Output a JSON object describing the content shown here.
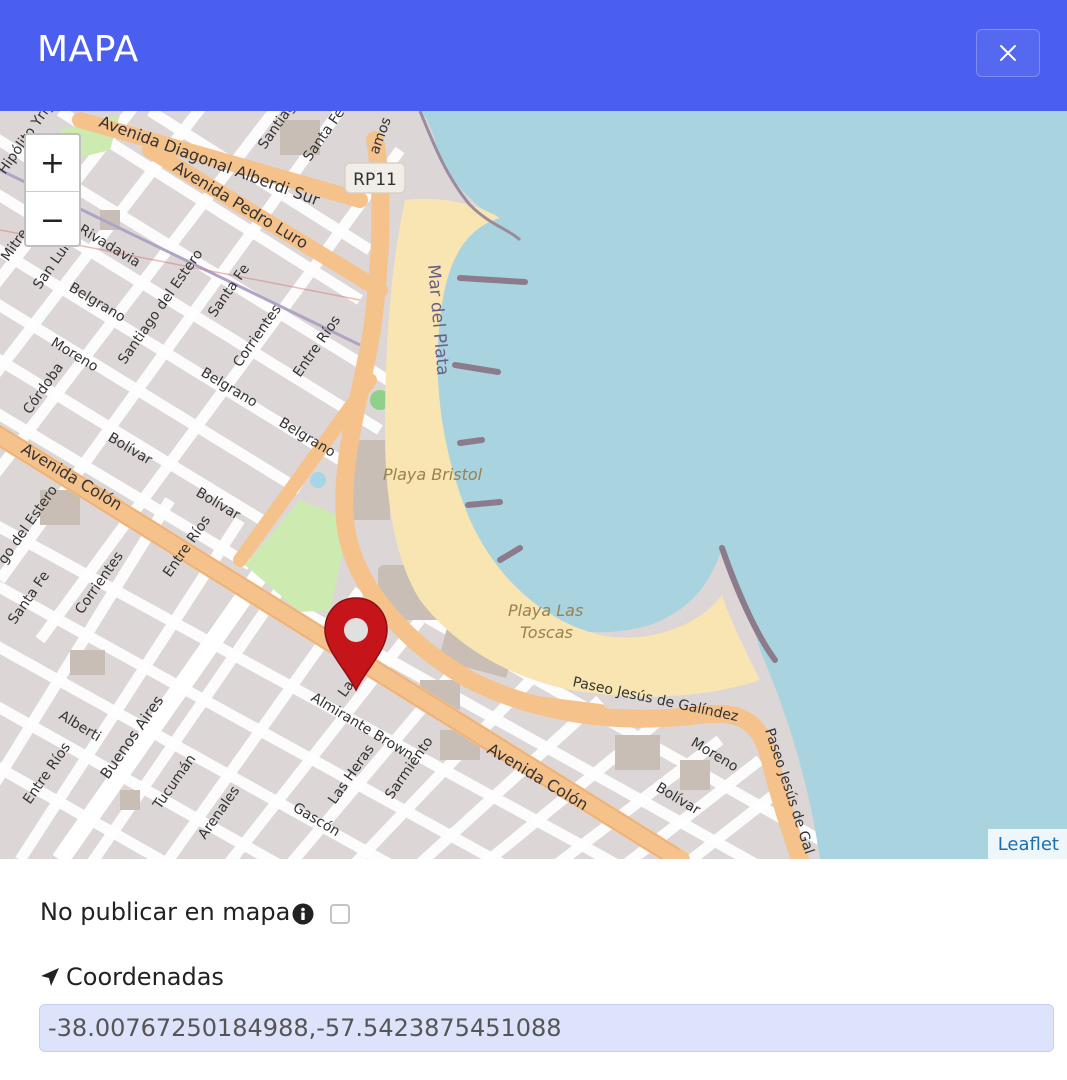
{
  "modal": {
    "title": "MAPA",
    "close_icon": "close-icon"
  },
  "map": {
    "zoom_in_label": "+",
    "zoom_out_label": "−",
    "attribution": "Leaflet",
    "marker_icon": "map-pin-icon",
    "colors": {
      "water": "#a9d3df",
      "beach": "#f9e5b1",
      "land": "#dcd7d6",
      "main_road": "#f5c28c",
      "street": "#ffffff",
      "park": "#cdebb0",
      "marker": "#c6141b"
    },
    "labels": {
      "avenida_diagonal": "Avenida Diagonal Alberdi Sur",
      "avenida_pedro_luro": "Avenida Pedro Luro",
      "rp11": "RP11",
      "mar_del_plata": "Mar del Plata",
      "playa_bristol": "Playa Bristol",
      "playa_las_toscas_1": "Playa Las",
      "playa_las_toscas_2": "Toscas",
      "avenida_colon_left": "Avenida Colón",
      "avenida_colon_right": "Avenida Colón",
      "paseo_galindez": "Paseo Jesús de Galíndez",
      "paseo_jesus_de_gal": "Paseo Jesús de Gal",
      "almirante_brown": "Almirante Brown",
      "las_heras": "Las Heras",
      "sarmiento": "Sarmiento",
      "moreno_right": "Moreno",
      "bolivar_right": "Bolívar",
      "gascon": "Gascón",
      "arenales": "Arenales",
      "tucuman": "Tucumán",
      "buenos_aires": "Buenos Aires",
      "alberti": "Alberti",
      "entre_rios_bottom": "Entre Ríos",
      "santa_fe_bottom": "Santa Fe",
      "corrientes_bottom": "Corrientes",
      "entre_rios_mid": "Entre Ríos",
      "bolivar_mid": "Bolívar",
      "bolivar_mid2": "Bolívar",
      "belgrano_mid": "Belgrano",
      "belgrano_mid2": "Belgrano",
      "belgrano_left": "Belgrano",
      "moreno_left": "Moreno",
      "cordoba": "Córdoba",
      "santiago_del_estero": "Santiago del Estero",
      "santiago_del_estero_left": "go del Estero",
      "santa_fe_mid": "Santa Fe",
      "corrientes_mid": "Corrientes",
      "entre_rios_top": "Entre Ríos",
      "san_luis": "San Luis",
      "rivadavia": "Rivadavia",
      "santa_fe_top": "Santa Fe",
      "santiago_top": "Santiago",
      "mitre": "Mitre",
      "hipolito_yrigoyen": "Hipólito Yrigoyen",
      "lamadrid": "Lar",
      "ramos": "amos"
    }
  },
  "form": {
    "no_publicar_label": "No publicar en mapa",
    "info_icon": "info-circle-icon",
    "no_publicar_checked": false,
    "coordinates_icon": "location-arrow-icon",
    "coordinates_label": "Coordenadas",
    "coordinates_value": "-38.00767250184988,-57.5423875451088"
  }
}
